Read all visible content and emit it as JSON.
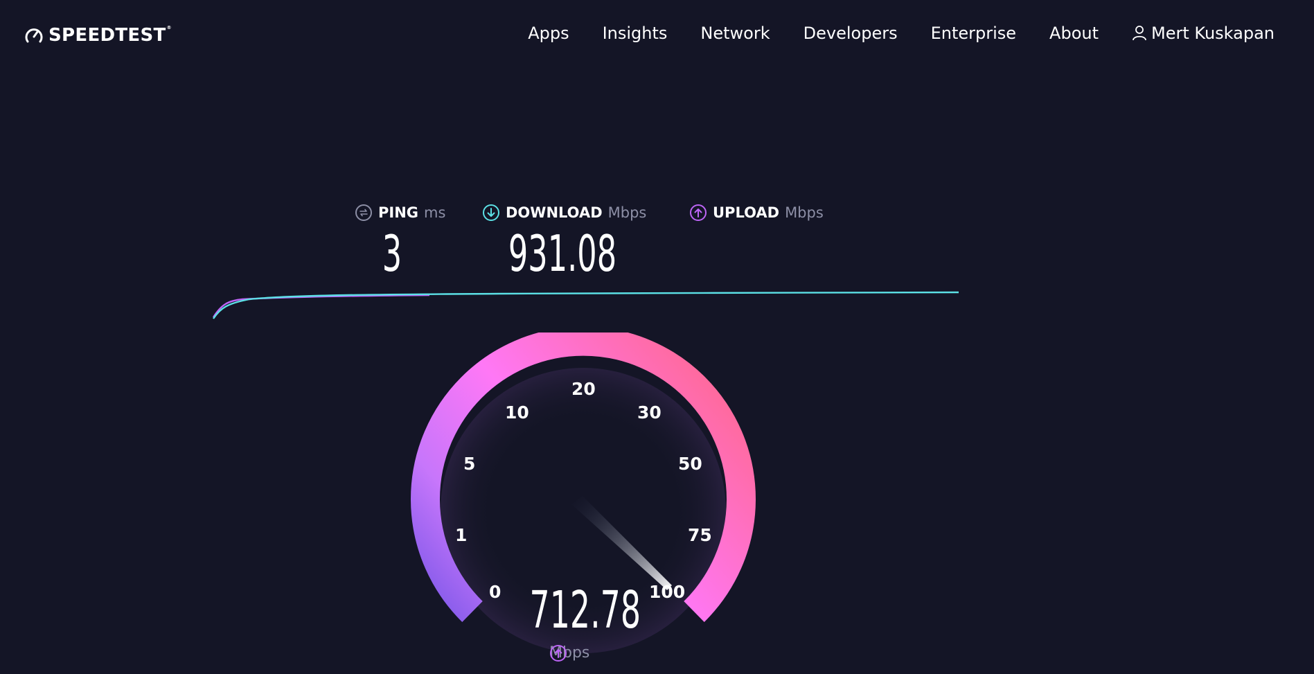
{
  "brand": {
    "name": "SPEEDTEST",
    "trademark": "®"
  },
  "nav": {
    "items": [
      "Apps",
      "Insights",
      "Network",
      "Developers",
      "Enterprise",
      "About"
    ],
    "user_name": "Mert Kuskapan",
    "user_icon": "user-icon"
  },
  "results": {
    "ping": {
      "label": "PING",
      "unit": "ms",
      "value": "3",
      "icon": "ping-icon"
    },
    "download": {
      "label": "DOWNLOAD",
      "unit": "Mbps",
      "value": "931.08",
      "icon": "download-arrow-icon"
    },
    "upload": {
      "label": "UPLOAD",
      "unit": "Mbps",
      "value": "",
      "icon": "upload-arrow-icon"
    }
  },
  "gauge": {
    "value": "712.78",
    "unit": "Mbps",
    "unit_icon": "upload-arrow-icon",
    "ticks": [
      "0",
      "1",
      "5",
      "10",
      "20",
      "30",
      "50",
      "75",
      "100"
    ],
    "needle_scale_fraction": 1.0
  },
  "colors": {
    "background": "#141526",
    "download": "#5ce1e6",
    "upload": "#bd65f6",
    "gauge_start": "#7b57e8",
    "gauge_mid": "#ff6ef8",
    "gauge_end": "#ff6a9f"
  }
}
